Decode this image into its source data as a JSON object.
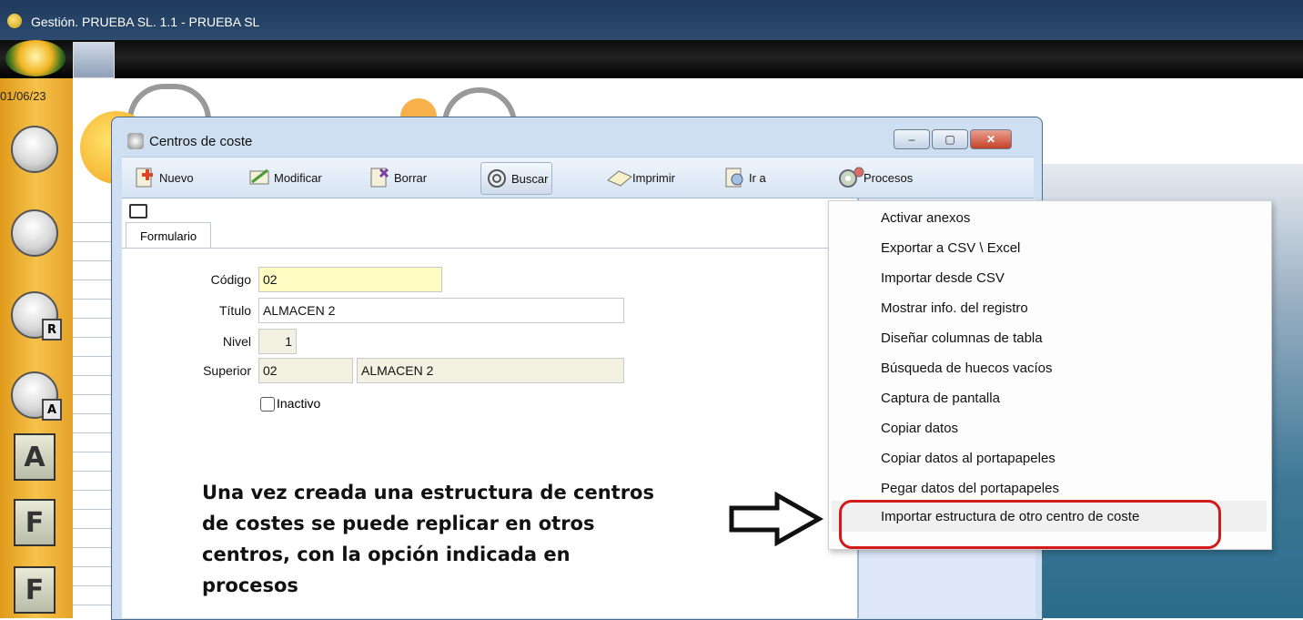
{
  "app": {
    "title": "Gestión. PRUEBA SL. 1.1 - PRUEBA SL",
    "date": "01/06/23"
  },
  "sidebar": {
    "letters": [
      "R",
      "A",
      "A",
      "F",
      "F"
    ]
  },
  "window": {
    "title": "Centros de coste",
    "controls": {
      "minimize": "–",
      "maximize": "▢",
      "close": "✕"
    },
    "toolbar": [
      "Nuevo",
      "Modificar",
      "Borrar",
      "Buscar",
      "Imprimir",
      "Ir a",
      "Procesos"
    ],
    "tab": "Formulario",
    "form": {
      "codigo_label": "Código",
      "codigo_value": "02",
      "titulo_label": "Título",
      "titulo_value": "ALMACEN 2",
      "nivel_label": "Nivel",
      "nivel_value": "1",
      "superior_label": "Superior",
      "superior_code": "02",
      "superior_name": "ALMACEN 2",
      "inactivo_label": "Inactivo"
    }
  },
  "note": [
    "Una vez creada una estructura de centros",
    "de costes se puede replicar en otros",
    "centros, con la opción indicada en",
    "procesos"
  ],
  "menu": {
    "items": [
      "Activar anexos",
      "Exportar a CSV \\ Excel",
      "Importar desde CSV",
      "Mostrar info. del registro",
      "Diseñar columnas de tabla",
      "Búsqueda de huecos vacíos",
      "Captura de pantalla",
      "Copiar datos",
      "Copiar datos al portapapeles",
      "Pegar datos del portapapeles",
      "Importar estructura de otro centro de coste"
    ],
    "highlighted_index": 10,
    "highlight_color": "#d21a1a"
  },
  "icons": [
    "app-icon",
    "orb-icon",
    "gear-icon",
    "grid-icon",
    "arrow-right-icon",
    "users-icon",
    "user-icon"
  ]
}
